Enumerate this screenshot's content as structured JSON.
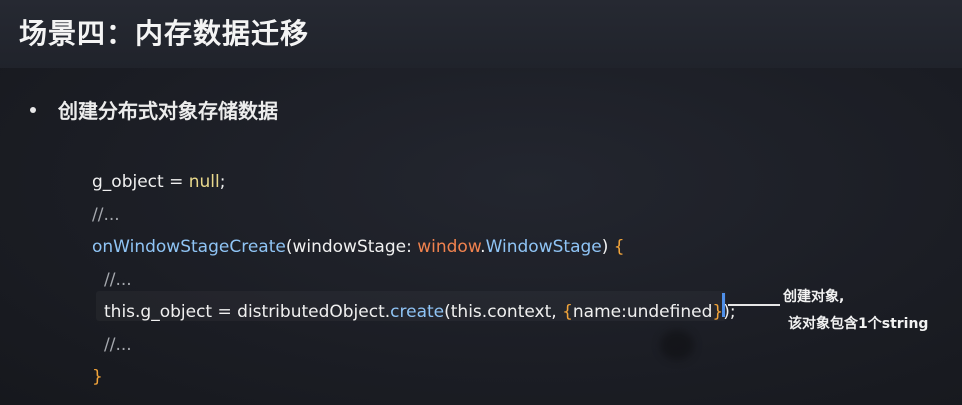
{
  "slide": {
    "title": "场景四：内存数据迁移",
    "bullet": "创建分布式对象存储数据"
  },
  "code": {
    "line1": {
      "ident": "g_object",
      "op": " = ",
      "value": "null",
      "end": ";"
    },
    "line2": "//...",
    "line3": {
      "fn": "onWindowStageCreate",
      "open": "(",
      "param": "windowStage: ",
      "ns": "window",
      "dot": ".",
      "type": "WindowStage",
      "close": ") ",
      "brace": "{"
    },
    "line4": "//...",
    "line5": {
      "obj": "this.g_object = distributedObject.",
      "method": "create",
      "open": "(",
      "args": "this.context, ",
      "lbrace": "{",
      "inner": "name:undefined",
      "rbrace": "}",
      "end": ");"
    },
    "line6": "//...",
    "line7": "}"
  },
  "callout": {
    "line1": "创建对象,",
    "line2": "该对象包含1个string"
  },
  "colors": {
    "keyword_blue": "#8fc4f5",
    "type_orange": "#f0824e",
    "value_yellow": "#e9d98c",
    "brace_gold": "#f2a43a",
    "cursor_blue": "#4f8fe8"
  }
}
